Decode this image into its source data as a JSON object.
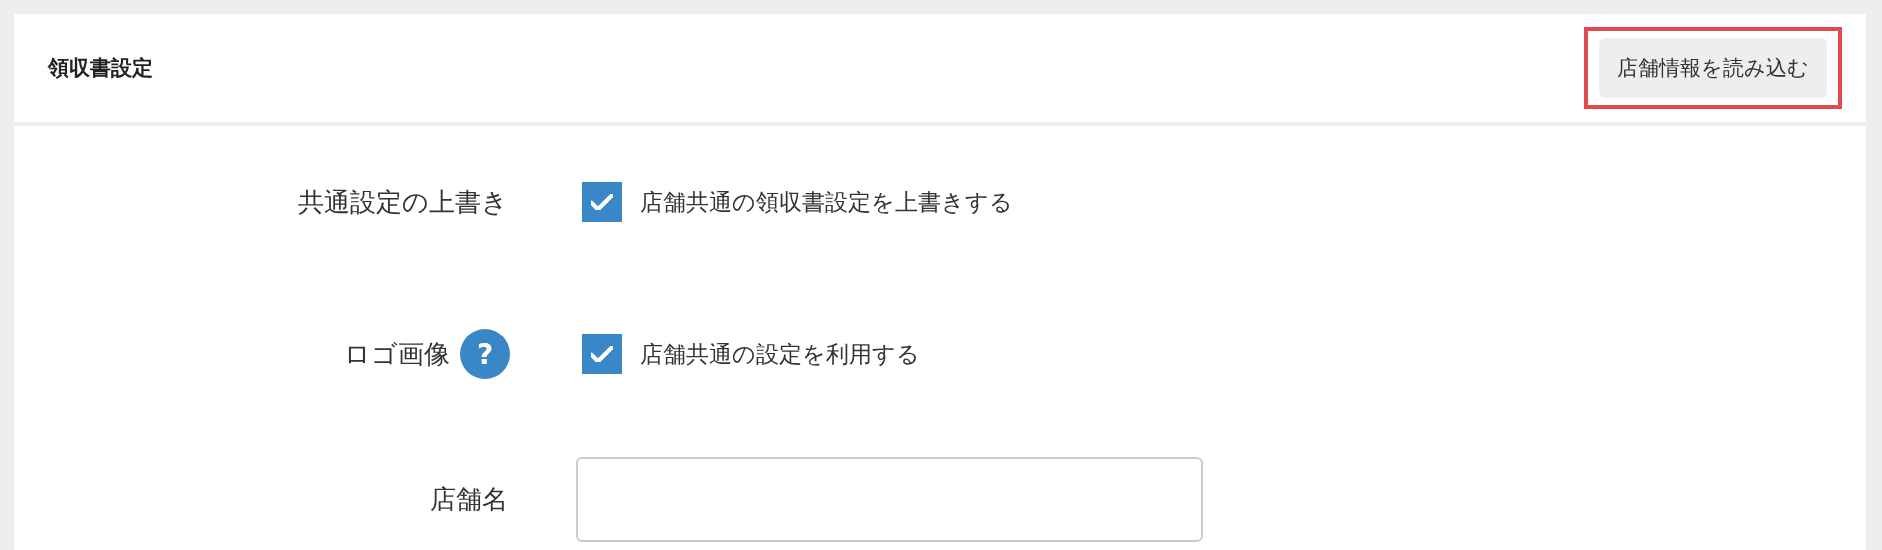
{
  "header": {
    "title": "領収書設定",
    "button": {
      "label": "店舗情報を読み込む",
      "highlighted": true
    }
  },
  "rows": [
    {
      "kind": "checkbox",
      "label": "共通設定の上書き",
      "checked": true,
      "text": "店舗共通の領収書設定を上書きする"
    },
    {
      "kind": "checkbox",
      "label": "ロゴ画像",
      "help_icon": "?",
      "checked": true,
      "text": "店舗共通の設定を利用する"
    },
    {
      "kind": "input",
      "label": "店舗名"
    }
  ]
}
